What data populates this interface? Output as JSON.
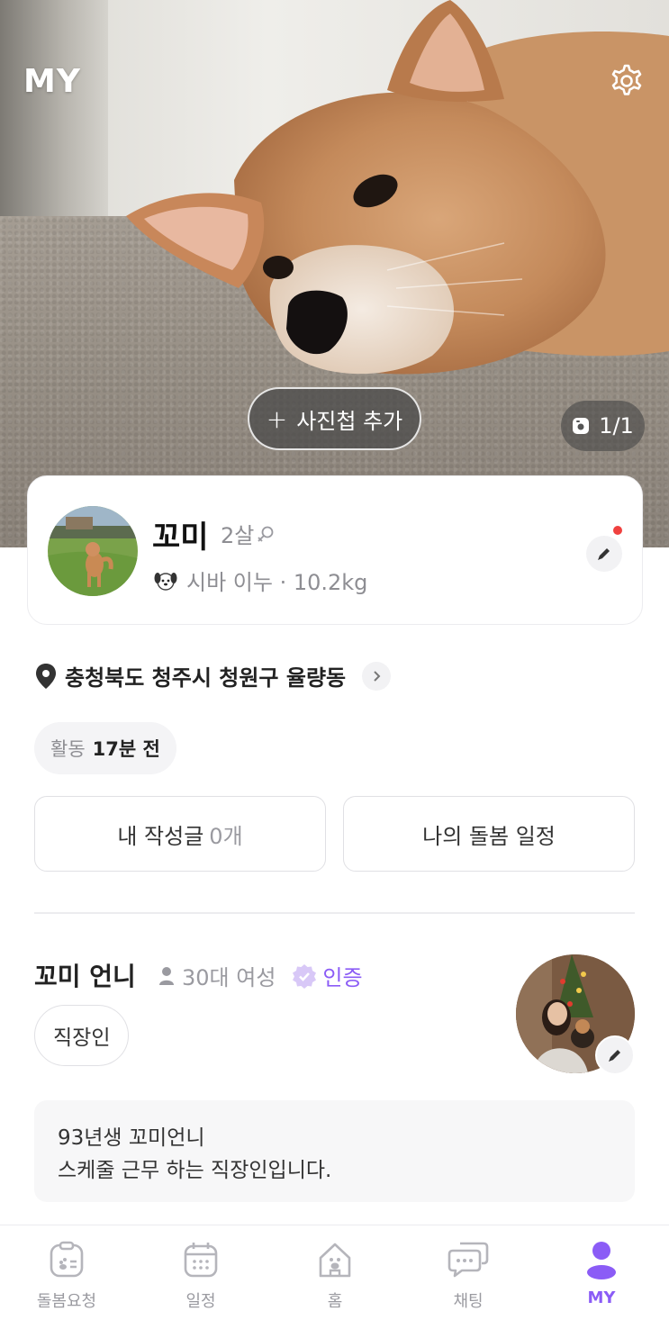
{
  "header": {
    "title": "MY",
    "settings_icon": "gear-icon"
  },
  "photo": {
    "add_album_label": "사진첩 추가",
    "counter": "1/1"
  },
  "pet": {
    "name": "꼬미",
    "age": "2살",
    "gender_icon": "female-icon",
    "breed_weight": "시바 이누 · 10.2kg",
    "has_new_badge": true
  },
  "location": {
    "text": "충청북도 청주시 청원구 율량동"
  },
  "activity": {
    "label": "활동",
    "value": "17분 전"
  },
  "actions": {
    "my_posts_label": "내 작성글",
    "my_posts_count": "0개",
    "care_schedule_label": "나의 돌봄 일정"
  },
  "owner": {
    "name": "꼬미 언니",
    "demographic": "30대 여성",
    "verified_label": "인증",
    "job": "직장인",
    "bio_line1": "93년생 꼬미언니",
    "bio_line2": "스케줄 근무 하는 직장인입니다."
  },
  "tabs": [
    {
      "label": "돌봄요청",
      "icon": "care-request-icon",
      "active": false
    },
    {
      "label": "일정",
      "icon": "calendar-icon",
      "active": false
    },
    {
      "label": "홈",
      "icon": "home-icon",
      "active": false
    },
    {
      "label": "채팅",
      "icon": "chat-icon",
      "active": false
    },
    {
      "label": "MY",
      "icon": "person-icon",
      "active": true
    }
  ],
  "colors": {
    "accent": "#8b5cf6",
    "badge_red": "#f0413f"
  }
}
